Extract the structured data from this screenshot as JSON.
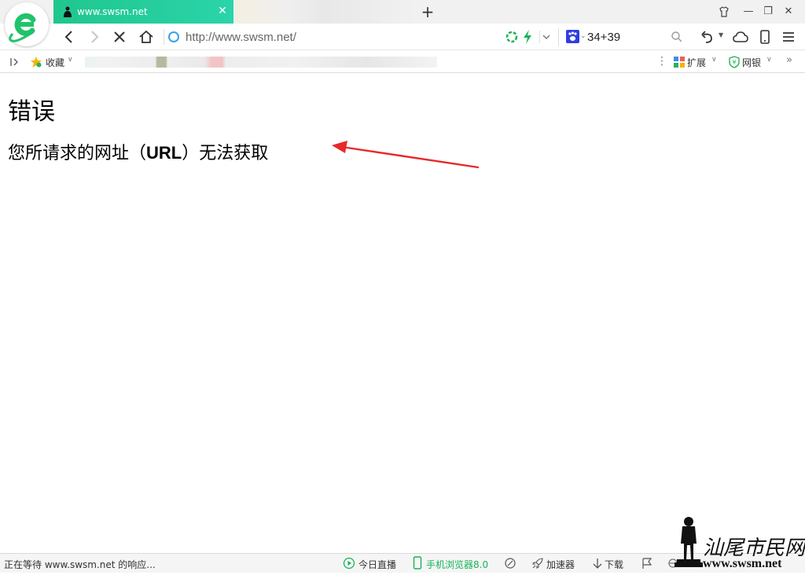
{
  "tab": {
    "title": "www.swsm.net",
    "close": "✕"
  },
  "new_tab_label": "+",
  "window_controls": {
    "skin": "skin-icon",
    "minimize": "—",
    "restore": "❐",
    "close": "✕"
  },
  "nav": {
    "address_value": "http://www.swsm.net/",
    "search_value": "34+39"
  },
  "bookmarks": {
    "favorites_label": "收藏",
    "extensions_label": "扩展",
    "netbank_label": "网银",
    "more": "»"
  },
  "page": {
    "heading": "错误",
    "message_before": "您所请求的网址（",
    "message_url": "URL",
    "message_after": "）无法获取"
  },
  "status": {
    "text": "正在等待 www.swsm.net 的响应...",
    "live": "今日直播",
    "mobile_browser": "手机浏览器8.0",
    "accelerator": "加速器",
    "download": "下载"
  },
  "watermark": {
    "site": "www.swsm.net",
    "name": "汕尾市民网"
  },
  "colors": {
    "tab_green": "#1fc68e",
    "arrow_red": "#e8282b",
    "status_green": "#18b35b"
  }
}
